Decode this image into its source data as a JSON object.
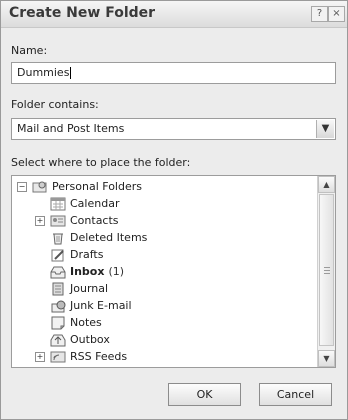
{
  "dialog": {
    "title": "Create New Folder",
    "help_glyph": "?",
    "close_glyph": "×"
  },
  "name": {
    "label": "Name:",
    "value": "Dummies"
  },
  "contains": {
    "label": "Folder contains:",
    "value": "Mail and Post Items"
  },
  "location": {
    "label": "Select where to place the folder:",
    "root": "Personal Folders",
    "items": [
      {
        "label": "Calendar",
        "icon": "calendar-icon"
      },
      {
        "label": "Contacts",
        "icon": "contacts-icon"
      },
      {
        "label": "Deleted Items",
        "icon": "deleted-items-icon"
      },
      {
        "label": "Drafts",
        "icon": "drafts-icon"
      },
      {
        "label": "Inbox",
        "count": "(1)",
        "icon": "inbox-icon"
      },
      {
        "label": "Journal",
        "icon": "journal-icon"
      },
      {
        "label": "Junk E-mail",
        "icon": "junk-email-icon"
      },
      {
        "label": "Notes",
        "icon": "notes-icon"
      },
      {
        "label": "Outbox",
        "icon": "outbox-icon"
      },
      {
        "label": "RSS Feeds",
        "icon": "rss-feeds-icon"
      }
    ]
  },
  "buttons": {
    "ok": "OK",
    "cancel": "Cancel"
  }
}
